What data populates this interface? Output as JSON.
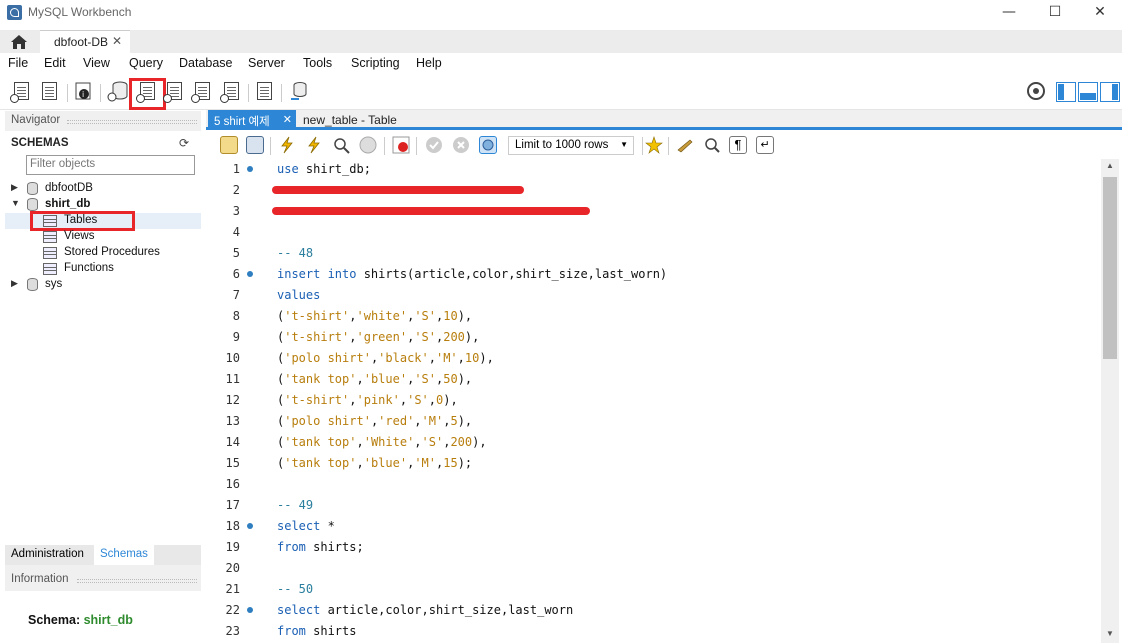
{
  "window": {
    "title": "MySQL Workbench",
    "controls": {
      "minimize": "—",
      "maximize": "☐",
      "close": "✕"
    }
  },
  "connection_tab": {
    "label": "dbfoot-DB",
    "close": "✕"
  },
  "menu": [
    "File",
    "Edit",
    "View",
    "Query",
    "Database",
    "Server",
    "Tools",
    "Scripting",
    "Help"
  ],
  "navigator": {
    "header": "Navigator",
    "schemas_title": "SCHEMAS",
    "filter_placeholder": "Filter objects",
    "tree": {
      "db1": "dbfootDB",
      "db2": "shirt_db",
      "children": [
        "Tables",
        "Views",
        "Stored Procedures",
        "Functions"
      ],
      "db3": "sys"
    },
    "tabs": [
      "Administration",
      "Schemas"
    ],
    "info_header": "Information",
    "info_label": "Schema: ",
    "info_value": "shirt_db"
  },
  "editor": {
    "tabs": [
      "5 shirt 예제",
      "new_table - Table"
    ],
    "limit_label": "Limit to 1000 rows",
    "lines": [
      {
        "n": "1",
        "m": true
      },
      {
        "n": "2",
        "m": false
      },
      {
        "n": "3",
        "m": false
      },
      {
        "n": "4",
        "m": false
      },
      {
        "n": "5",
        "m": false
      },
      {
        "n": "6",
        "m": true
      },
      {
        "n": "7",
        "m": false
      },
      {
        "n": "8",
        "m": false
      },
      {
        "n": "9",
        "m": false
      },
      {
        "n": "10",
        "m": false
      },
      {
        "n": "11",
        "m": false
      },
      {
        "n": "12",
        "m": false
      },
      {
        "n": "13",
        "m": false
      },
      {
        "n": "14",
        "m": false
      },
      {
        "n": "15",
        "m": false
      },
      {
        "n": "16",
        "m": false
      },
      {
        "n": "17",
        "m": false
      },
      {
        "n": "18",
        "m": true
      },
      {
        "n": "19",
        "m": false
      },
      {
        "n": "20",
        "m": false
      },
      {
        "n": "21",
        "m": false
      },
      {
        "n": "22",
        "m": true
      },
      {
        "n": "23",
        "m": false
      }
    ],
    "code": {
      "l1": [
        "use",
        " shirt_db;"
      ],
      "l5": "-- 48",
      "l6": [
        "insert into",
        " shirts(article,color,shirt_size,last_worn)"
      ],
      "l7": "values",
      "rows": [
        [
          "'t-shirt'",
          "'white'",
          "'S'",
          "10",
          "),"
        ],
        [
          "'t-shirt'",
          "'green'",
          "'S'",
          "200",
          "),"
        ],
        [
          "'polo shirt'",
          "'black'",
          "'M'",
          "10",
          "),"
        ],
        [
          "'tank top'",
          "'blue'",
          "'S'",
          "50",
          "),"
        ],
        [
          "'t-shirt'",
          "'pink'",
          "'S'",
          "0",
          "),"
        ],
        [
          "'polo shirt'",
          "'red'",
          "'M'",
          "5",
          "),"
        ],
        [
          "'tank top'",
          "'White'",
          "'S'",
          "200",
          "),"
        ],
        [
          "'tank top'",
          "'blue'",
          "'M'",
          "15",
          ");"
        ]
      ],
      "l17": "-- 49",
      "l18": [
        "select",
        " *"
      ],
      "l19": [
        "from",
        " shirts;"
      ],
      "l21": "-- 50",
      "l22": [
        "select",
        " article,color,shirt_size,last_worn"
      ],
      "l23": [
        "from",
        " shirts"
      ]
    }
  }
}
